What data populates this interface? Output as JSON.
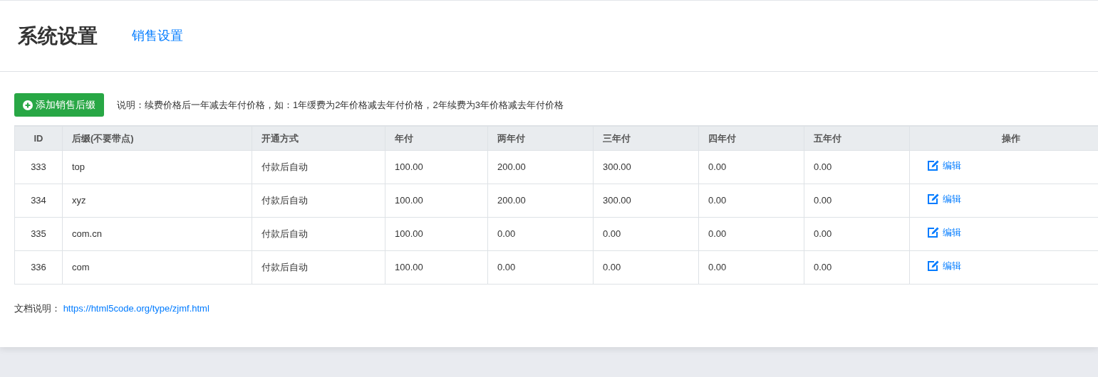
{
  "header": {
    "title": "系统设置",
    "tabs": [
      {
        "label": "销售设置"
      }
    ]
  },
  "toolbar": {
    "add_button": "添加销售后缀",
    "note": "说明：续费价格后一年减去年付价格，如：1年缓费为2年价格减去年付价格，2年续费为3年价格减去年付价格"
  },
  "table": {
    "columns": [
      "ID",
      "后缀(不要带点)",
      "开通方式",
      "年付",
      "两年付",
      "三年付",
      "四年付",
      "五年付",
      "操作"
    ],
    "rows": [
      {
        "cells": [
          "333",
          "top",
          "付款后自动",
          "100.00",
          "200.00",
          "300.00",
          "0.00",
          "0.00"
        ],
        "action": "编辑"
      },
      {
        "cells": [
          "334",
          "xyz",
          "付款后自动",
          "100.00",
          "200.00",
          "300.00",
          "0.00",
          "0.00"
        ],
        "action": "编辑"
      },
      {
        "cells": [
          "335",
          "com.cn",
          "付款后自动",
          "100.00",
          "0.00",
          "0.00",
          "0.00",
          "0.00"
        ],
        "action": "编辑"
      },
      {
        "cells": [
          "336",
          "com",
          "付款后自动",
          "100.00",
          "0.00",
          "0.00",
          "0.00",
          "0.00"
        ],
        "action": "编辑"
      }
    ]
  },
  "footer": {
    "label": "文档说明：",
    "link": "https://html5code.org/type/zjmf.html"
  }
}
